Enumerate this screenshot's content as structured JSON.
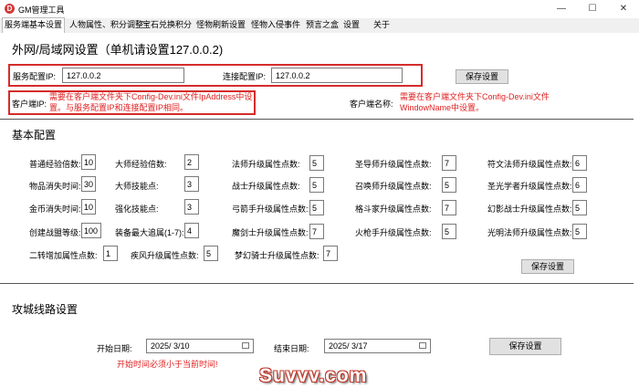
{
  "window": {
    "title": "GM管理工具",
    "icon_letter": "D",
    "controls": [
      "minimize-icon",
      "maximize-icon",
      "close-icon"
    ]
  },
  "tabs": [
    {
      "label": "服务端基本设置",
      "active": true
    },
    {
      "label": "人物属性、积分调整"
    },
    {
      "label": "宝石兑换积分"
    },
    {
      "label": "怪物刷新设置"
    },
    {
      "label": "怪物入侵事件"
    },
    {
      "label": "预言之盒"
    },
    {
      "label": "设置"
    },
    {
      "label": "关于"
    }
  ],
  "network": {
    "heading": "外网/局域网设置（单机请设置127.0.0.2)",
    "server_ip_label": "服务配置IP:",
    "server_ip": "127.0.0.2",
    "connect_ip_label": "连接配置IP:",
    "connect_ip": "127.0.0.2",
    "save": "保存设置",
    "client_ip_label": "客户端IP:",
    "client_ip_note": "需要在客户端文件夹下Config-Dev.ini文件IpAddress中设置。与服务配置IP和连接配置IP相同。",
    "client_name_label": "客户端名称:",
    "client_name_note": "需要在客户端文件夹下Config-Dev.ini文件WindowName中设置。"
  },
  "basic": {
    "heading": "基本配置",
    "save": "保存设置",
    "rows": [
      [
        {
          "label": "普通经验倍数:",
          "value": "10"
        },
        {
          "label": "大师经验倍数:",
          "value": "2"
        },
        {
          "label": "法师升级属性点数:",
          "value": "5"
        },
        {
          "label": "圣导师升级属性点数:",
          "value": "7"
        },
        {
          "label": "符文法师升级属性点数:",
          "value": "6"
        }
      ],
      [
        {
          "label": "物品消失时间:",
          "value": "30"
        },
        {
          "label": "大师技能点:",
          "value": "3"
        },
        {
          "label": "战士升级属性点数:",
          "value": "5"
        },
        {
          "label": "召唤师升级属性点数:",
          "value": "5"
        },
        {
          "label": "圣光学者升级属性点数:",
          "value": "6"
        }
      ],
      [
        {
          "label": "金币消失时间:",
          "value": "10"
        },
        {
          "label": "强化技能点:",
          "value": "3"
        },
        {
          "label": "弓箭手升级属性点数:",
          "value": "5"
        },
        {
          "label": "格斗家升级属性点数:",
          "value": "7"
        },
        {
          "label": "幻影战士升级属性点数:",
          "value": "5"
        }
      ],
      [
        {
          "label": "创建战盟等级:",
          "value": "100"
        },
        {
          "label": "装备最大追属(1-7):",
          "value": "4"
        },
        {
          "label": "魔剑士升级属性点数:",
          "value": "7"
        },
        {
          "label": "火枪手升级属性点数:",
          "value": "5"
        },
        {
          "label": "光明法师升级属性点数:",
          "value": "5"
        }
      ]
    ],
    "row5": [
      {
        "label": "二转增加属性点数:",
        "value": "1"
      },
      {
        "label": "疾风升级属性点数:",
        "value": "5"
      },
      {
        "label": "梦幻骑士升级属性点数:",
        "value": "7"
      }
    ]
  },
  "siege": {
    "heading": "攻城线路设置",
    "start_label": "开始日期:",
    "start_date": "2025/ 3/10",
    "end_label": "结束日期:",
    "end_date": "2025/ 3/17",
    "save": "保存设置",
    "warning": "开始时间必须小于当前时间!"
  },
  "watermark": "Suvvv.com",
  "colors": {
    "highlight_red": "#d62b2b",
    "note_red": "#e02020"
  }
}
